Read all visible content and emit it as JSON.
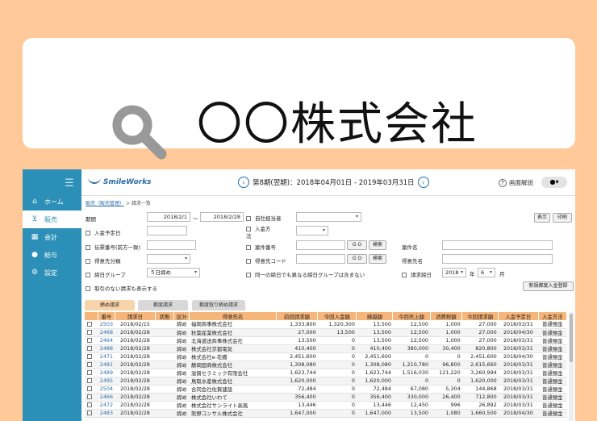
{
  "search": {
    "query": "〇〇株式会社"
  },
  "sidebar": {
    "items": [
      {
        "label": "ホーム",
        "icon": "home-icon",
        "glyph": "⌂"
      },
      {
        "label": "販売",
        "icon": "cart-icon",
        "glyph": "🛒"
      },
      {
        "label": "会計",
        "icon": "calculator-icon",
        "glyph": "▦"
      },
      {
        "label": "給与",
        "icon": "money-bag-icon",
        "glyph": "●"
      },
      {
        "label": "設定",
        "icon": "gear-icon",
        "glyph": "⚙"
      }
    ]
  },
  "header": {
    "logo": "SmileWorks",
    "period": "第8期(翌期)：2018年04月01日 - 2019年03月31日",
    "help": "画面解説"
  },
  "breadcrumb": {
    "link": "販売（販売管理）",
    "current": "> 請求一覧"
  },
  "form": {
    "period_label": "期間",
    "period_from": "2018/2/1",
    "period_sep": "〜",
    "period_to": "2018/2/28",
    "staff_label": "自社担当者",
    "payment_method_label": "入金方法",
    "display_btn": "表示",
    "print_btn": "印刷",
    "due_date_label": "入金予定日",
    "slip_no_label": "伝票番号(前方一致)",
    "project_no_label": "案件番号",
    "go_label": "G O",
    "search_btn": "検索",
    "project_name_label": "案件名",
    "customer_class_label": "得意先分類",
    "customer_code_label": "得意先コード",
    "customer_name_label": "得意先名",
    "closing_group_label": "締日グループ",
    "closing_group_value": "５日締め",
    "same_closing_label": "同一の締日でも異なる締日グループは含まない",
    "billing_closing_label": "請求締日",
    "year_value": "2018",
    "year_unit": "年",
    "month_value": "6",
    "month_unit": "月",
    "show_no_transactions_label": "取引のない請求も表示する",
    "new_payment_btn": "新規都度入金登録"
  },
  "tabs": [
    "締め請求",
    "都度請求",
    "都度取り締め請求"
  ],
  "table": {
    "headers": [
      "",
      "番号",
      "請求日",
      "状態",
      "区分",
      "得意先名",
      "前回請求額",
      "今回入金額",
      "繰越額",
      "今回売上額",
      "消費税額",
      "今回請求額",
      "入金予定日",
      "入金方法"
    ],
    "rows": [
      [
        "2503",
        "2018/02/15",
        "",
        "締め",
        "福岡商事株式会社",
        "1,333,800",
        "1,320,300",
        "13,500",
        "12,500",
        "1,000",
        "27,000",
        "2018/03/31",
        "普通預金"
      ],
      [
        "2468",
        "2018/02/28",
        "",
        "締め",
        "秋葉産業株式会社",
        "27,000",
        "13,500",
        "13,500",
        "12,500",
        "1,000",
        "27,000",
        "2018/04/30",
        "普通預金"
      ],
      [
        "2464",
        "2018/02/28",
        "",
        "締め",
        "北海道送商事株式会社",
        "13,500",
        "0",
        "13,500",
        "12,500",
        "1,000",
        "27,000",
        "2018/03/31",
        "普通預金"
      ],
      [
        "2488",
        "2018/02/28",
        "",
        "締め",
        "株式会社京都電気",
        "410,400",
        "0",
        "410,400",
        "380,000",
        "30,400",
        "820,800",
        "2018/03/31",
        "普通預金"
      ],
      [
        "2471",
        "2018/02/28",
        "",
        "締め",
        "株式会社e-花橋",
        "2,451,600",
        "0",
        "2,451,600",
        "0",
        "0",
        "2,451,600",
        "2018/04/30",
        "普通預金"
      ],
      [
        "2481",
        "2018/02/28",
        "",
        "締め",
        "静岡国商株式会社",
        "1,308,080",
        "0",
        "1,308,080",
        "1,210,780",
        "96,800",
        "2,615,660",
        "2018/03/31",
        "普通預金"
      ],
      [
        "2489",
        "2018/02/28",
        "",
        "締め",
        "滋賀セラミック有限会社",
        "1,623,744",
        "0",
        "1,623,744",
        "1,516,030",
        "121,220",
        "3,260,994",
        "2018/03/31",
        "普通預金"
      ],
      [
        "2495",
        "2018/02/28",
        "",
        "締め",
        "鳥取水産株式会社",
        "1,620,000",
        "0",
        "1,620,000",
        "0",
        "0",
        "1,620,000",
        "2018/03/31",
        "普通預金"
      ],
      [
        "2504",
        "2018/02/28",
        "",
        "締め",
        "合同会社佐賀建設",
        "72,484",
        "0",
        "72,484",
        "67,080",
        "5,304",
        "144,868",
        "2018/03/31",
        "普通預金"
      ],
      [
        "2466",
        "2018/02/28",
        "",
        "締め",
        "株式会社いわて",
        "356,400",
        "0",
        "356,400",
        "330,000",
        "26,400",
        "712,800",
        "2018/03/31",
        "普通預金"
      ],
      [
        "2472",
        "2018/02/28",
        "",
        "締め",
        "株式会社サンライト高風",
        "13,446",
        "0",
        "13,446",
        "12,450",
        "996",
        "26,892",
        "2018/03/31",
        "普通預金"
      ],
      [
        "2483",
        "2018/02/28",
        "",
        "締め",
        "熊野コンサル株式会社",
        "1,647,000",
        "0",
        "1,647,000",
        "13,500",
        "1,080",
        "1,660,500",
        "2018/04/30",
        "普通預金"
      ]
    ]
  },
  "colors": {
    "brand": "#2b8fb7",
    "accent": "#f6b579",
    "background": "#ffc99a"
  }
}
